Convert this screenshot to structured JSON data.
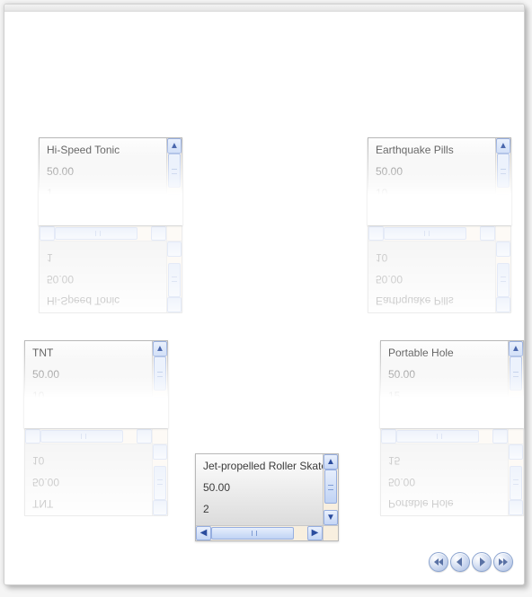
{
  "cards": [
    {
      "name": "Hi-Speed Tonic",
      "price": "50.00",
      "qty": "1"
    },
    {
      "name": "Earthquake Pills",
      "price": "50.00",
      "qty": "10"
    },
    {
      "name": "TNT",
      "price": "50.00",
      "qty": "10"
    },
    {
      "name": "Portable Hole",
      "price": "50.00",
      "qty": "15"
    },
    {
      "name": "Jet-propelled Roller Skates",
      "price": "50.00",
      "qty": "2"
    }
  ],
  "scroll_arrows": {
    "up": "▲",
    "down": "▼",
    "left": "◀",
    "right": "▶"
  },
  "nav": {
    "first": "first-button",
    "prev": "prev-button",
    "next": "next-button",
    "last": "last-button"
  },
  "colors": {
    "scrollbar": "#c5d6f5",
    "track": "#f8efdf"
  }
}
